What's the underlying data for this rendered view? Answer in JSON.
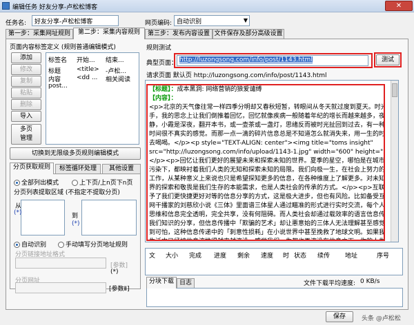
{
  "window": {
    "title": "编辑任务 好友分享-卢松松博客",
    "close": "✕"
  },
  "top": {
    "task_name_label": "任务名:",
    "task_name_value": "好友分享-卢松松博客",
    "encoding_label": "网页编码:",
    "encoding_value": "自动识别"
  },
  "tabs": [
    {
      "label": "第一步：采集网址规则"
    },
    {
      "label": "第二步：采集内容规则"
    },
    {
      "label": "第三步：发布内容设置"
    },
    {
      "label": "文件保存及部分高级设置"
    }
  ],
  "tag_def": {
    "group_title": "页面内容标签定义",
    "group_mode": "(规则普通编辑模式)",
    "buttons": [
      "添加",
      "修改",
      "复制",
      "粘贴",
      "删除",
      "导入"
    ],
    "multi_page": "多页\n管理",
    "columns": [
      "标签名",
      "开始...",
      "结束..."
    ],
    "rows": [
      [
        "标题",
        "<title>",
        "-卢松..."
      ],
      [
        "内容",
        "<dd ...",
        "相关阅读"
      ],
      [
        "post...",
        "",
        ""
      ]
    ],
    "switch_btn": "切换到无限级多页规则编辑模式"
  },
  "sub_tabs": [
    {
      "label": "分页获取规则"
    },
    {
      "label": "标签循环处理"
    },
    {
      "label": "其他设置"
    }
  ],
  "paging": {
    "mode1": "全部列出模式",
    "mode2": "上下页/上n页下n页",
    "area_label": "分页列表提取区域 (不指定不提取分页)",
    "from_label": "从",
    "to_label": "到",
    "star": "(*)",
    "auto_detect": "自动识别",
    "manual": "手动填写分页地址规则",
    "link_label": "分页链接地址格式",
    "param_btn": "[参数]",
    "paging_url_label": "分页网址",
    "param_btn2": "[参数Ⅱ]"
  },
  "test_rule": {
    "title": "规则测试",
    "page_label": "典型页面：",
    "url": "http://luzongsong.com/info/post/1143.html",
    "test_btn": "测试",
    "req_label": "请求页面 默认页",
    "req_url": "http://luzongsong.com/info/post/1143.html",
    "lines": [
      {
        "t": "【标题】：成本黑洞: 网络营销的狼爱谴缚",
        "g": "【标题】："
      },
      {
        "t": "【内容】：",
        "g": "【内容】："
      },
      {
        "t": "<p>北京的天气像往常一样四季分明却又春秋短暂，转眼间从冬天就过度到夏天。时光如",
        "g": ""
      },
      {
        "t": "手，我的思念上让我们倒推着回忆，回忆就像疾病一般随着年纪的增长而越来越多，夜深到人",
        "g": ""
      },
      {
        "t": "静，小霞是深夜，翻开本书，或一壶茶或一盏灯，思绪反而被时光扯回到过去，有一种悟",
        "g": ""
      },
      {
        "t": "时间很不真实的感觉。而那一点一滴的碎片信息总是不知道怎么就消失来，用一生的时间",
        "g": ""
      },
      {
        "t": "去喝喝。</p><p style=\"TEXT-ALIGN: center\"><img title=\"toms insight\"",
        "g": ""
      },
      {
        "t": "src=\"http://luzongsong.com/info/upload/1143-1.jpg\" width=\"600\" height=\"334\"/>",
        "g": ""
      },
      {
        "t": "</p><p>回忆让我们更好的展望未来和探索未知的世界。夏季的星空，哪怕是在城市的光",
        "g": ""
      },
      {
        "t": "污染下，都映衬着我们人类的无知和探索未知的局限。我们向极一生，在社会上努力的学习",
        "g": ""
      },
      {
        "t": "工作，从某种意义上来说也只是希望探知更多的信息，在各种维度上了解更多。对未知世",
        "g": ""
      },
      {
        "t": "界的探索和敬畏是我们生存的本能需求，也是人类社会的传承的方式。</p><p>互联网给",
        "g": ""
      },
      {
        "t": "予了我们更快捷更好对等的信息分享的方式，这是极大进步，但也有风险。比如备受互联",
        "g": ""
      },
      {
        "t": "网干播家的刘慈欣小说《三体》里面谱三体星人通过瞄准的形式进行实时交流，每个人的",
        "g": ""
      },
      {
        "t": "思维和信息完全透明，完全共享，没有何阻碍。而人类社会却通过载效率的语言信息传递",
        "g": ""
      },
      {
        "t": "我们知识的分享，但信息传播中「欺骗的艺术」却让悪意始的三体人无法理解甚至感觉",
        "g": ""
      },
      {
        "t": "到可怕，这种信息传递中的「刺意性损耗」在小说世界中甚至挽救了地球文明。如果我们的",
        "g": ""
      },
      {
        "t": "生活中已经被信息流推得越来越淹没，感觉我们一生都也再淹没在信息之下，你的人生信...",
        "g": ""
      }
    ]
  },
  "download": {
    "columns": [
      "文",
      "大小",
      "完成",
      "进度",
      "剩余",
      "速度",
      "时",
      "状态",
      "续传",
      "地址",
      "序号"
    ],
    "tabs": [
      {
        "label": "分块下载"
      },
      {
        "label": "日志"
      }
    ],
    "speed_label": "文件下载平均速度:",
    "speed_value": "0",
    "speed_unit": "KB/s"
  },
  "footer": {
    "save": "保存"
  },
  "watermark": "头条 @卢松松"
}
